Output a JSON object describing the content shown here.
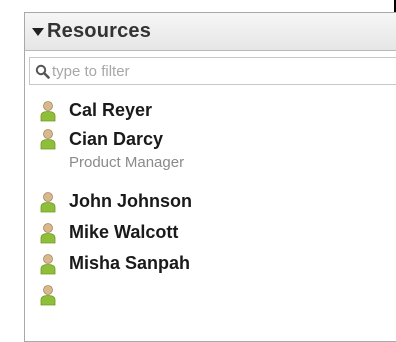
{
  "panel": {
    "title": "Resources",
    "filter": {
      "placeholder": "type to filter",
      "value": ""
    }
  },
  "resources": [
    {
      "name": "Cal Reyer",
      "role": ""
    },
    {
      "name": "Cian Darcy",
      "role": "Product Manager"
    },
    {
      "name": "John Johnson",
      "role": ""
    },
    {
      "name": "Mike Walcott",
      "role": ""
    },
    {
      "name": "Misha Sanpah",
      "role": ""
    }
  ],
  "icons": {
    "toggle": "triangle-down-icon",
    "search": "search-icon",
    "person": "person-icon"
  },
  "colors": {
    "person_head": "#d8b98f",
    "person_body": "#8fbf3a",
    "header_text": "#333333",
    "placeholder": "#a7a7a7",
    "subtitle": "#8a8a8a"
  }
}
